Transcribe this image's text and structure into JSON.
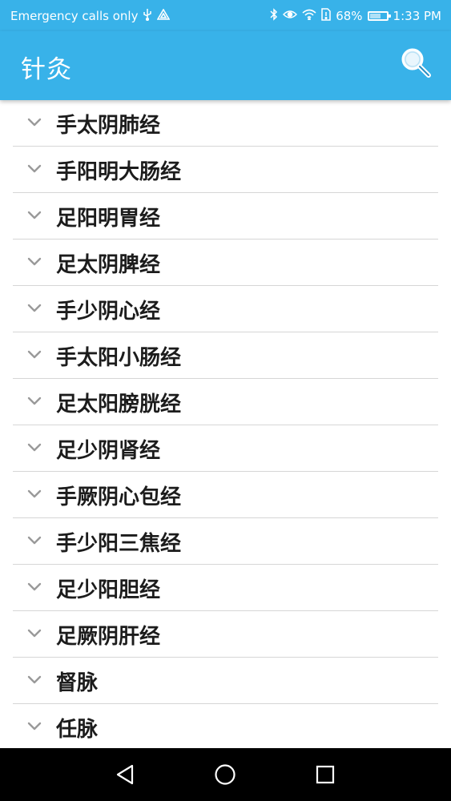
{
  "status_bar": {
    "carrier_text": "Emergency calls only",
    "battery_percent": "68%",
    "battery_level": 0.68,
    "time": "1:33 PM",
    "icons_left": [
      "usb-icon",
      "drive-icon"
    ],
    "icons_right": [
      "bluetooth-icon",
      "eye-comfort-icon",
      "wifi-icon",
      "sim-icon",
      "battery-icon"
    ]
  },
  "app_bar": {
    "title": "针灸",
    "background": "#38b2e9",
    "action_icon": "search-icon"
  },
  "meridians": [
    "手太阴肺经",
    "手阳明大肠经",
    "足阳明胃经",
    "足太阴脾经",
    "手少阴心经",
    "手太阳小肠经",
    "足太阳膀胱经",
    "足少阴肾经",
    "手厥阴心包经",
    "手少阳三焦经",
    "足少阳胆经",
    "足厥阴肝经",
    "督脉",
    "任脉"
  ],
  "navigation_bar": {
    "buttons": [
      "back-icon",
      "home-icon",
      "recents-icon"
    ]
  }
}
